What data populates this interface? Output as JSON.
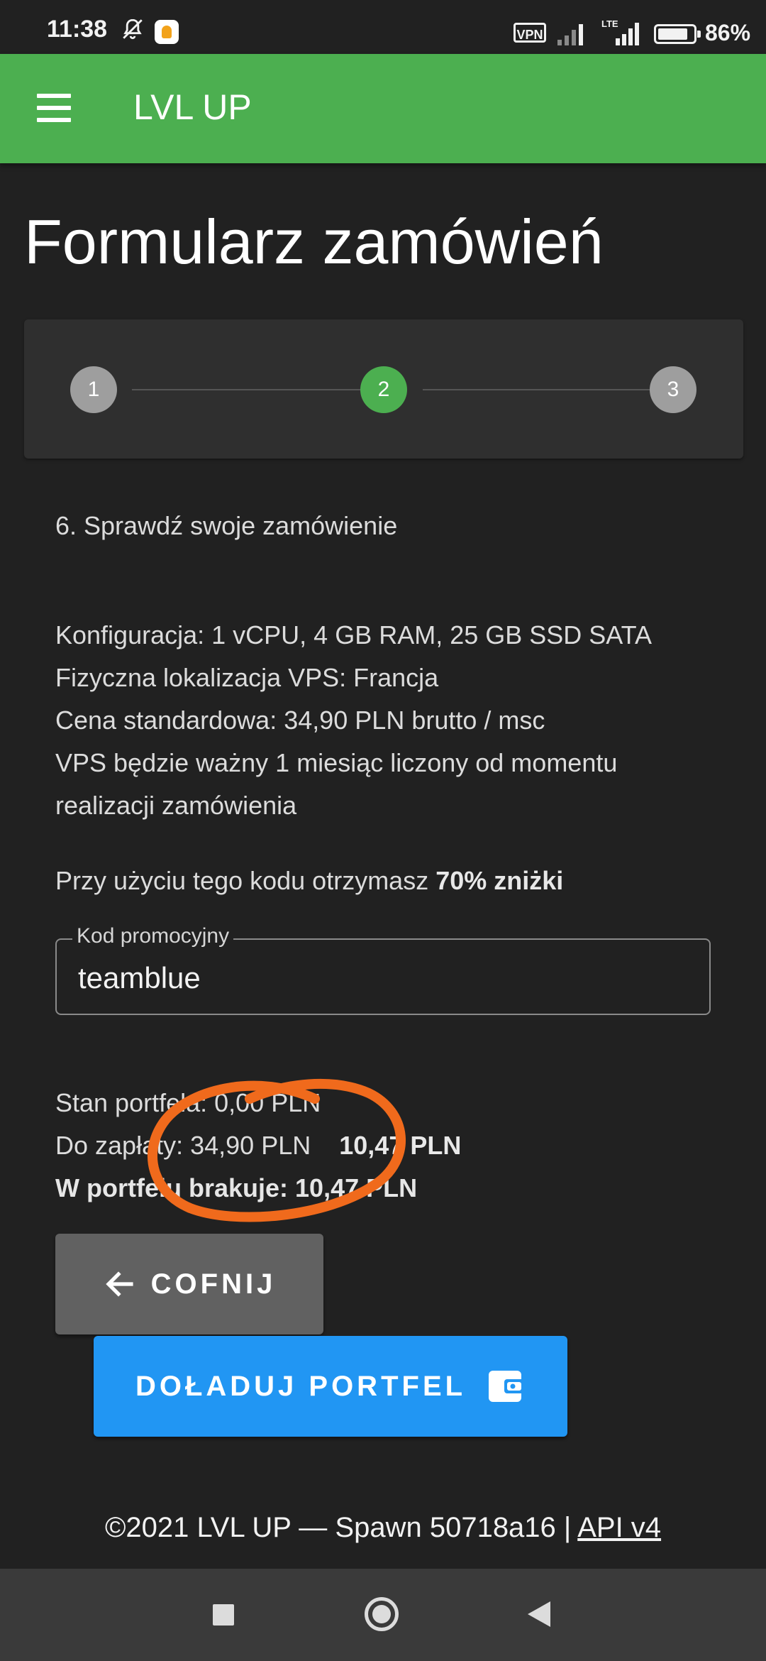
{
  "status_bar": {
    "time": "11:38",
    "vpn": "VPN",
    "network": "LTE",
    "battery_percent": "86%",
    "battery_level": 0.86
  },
  "app_bar": {
    "title": "LVL UP",
    "color": "#4caf50"
  },
  "page": {
    "title": "Formularz zamówień"
  },
  "stepper": {
    "steps": [
      "1",
      "2",
      "3"
    ],
    "active_step": 2
  },
  "section": {
    "heading": "6. Sprawdź swoje zamówienie"
  },
  "details": {
    "config": "Konfiguracja: 1 vCPU, 4 GB RAM, 25 GB SSD SATA",
    "location": "Fizyczna lokalizacja VPS: Francja",
    "price": "Cena standardowa: 34,90 PLN brutto / msc",
    "validity_line1": "VPS będzie ważny 1 miesiąc liczony od momentu",
    "validity_line2": "realizacji zamówienia"
  },
  "discount": {
    "text": "Przy użyciu tego kodu otrzymasz",
    "value": "70% zniżki"
  },
  "promo": {
    "label": "Kod promocyjny",
    "value": "teamblue"
  },
  "summary": {
    "wallet": "Stan portfela: 0,00 PLN",
    "to_pay_label": "Do zapłaty:",
    "to_pay_old": "34,90 PLN",
    "to_pay_new": "10,47 PLN",
    "missing_label": "W portfelu brakuje:",
    "missing_value": "10,47 PLN"
  },
  "buttons": {
    "back": "COFNIJ",
    "top_up": "DOŁADUJ PORTFEL"
  },
  "footer": {
    "text": "©2021 LVL UP — Spawn 50718a16 |",
    "link": "API v4"
  },
  "annotation": {
    "color": "#f06a1c"
  },
  "icons": {
    "menu": "hamburger-icon",
    "back": "arrow-left-icon",
    "wallet": "wallet-icon",
    "bell": "bell-muted-icon"
  }
}
